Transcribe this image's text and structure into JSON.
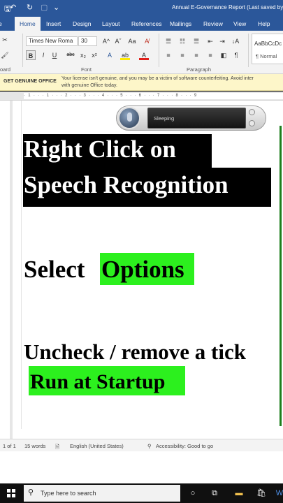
{
  "titlebar": {
    "title": "Annual E-Governance Report (Last saved by u",
    "save_glyph": "🖫",
    "undo_glyph": "↶",
    "redo_glyph": "↻",
    "dropdown_glyph": "⌄"
  },
  "ribbon_tabs": [
    "Home",
    "Insert",
    "Design",
    "Layout",
    "References",
    "Mailings",
    "Review",
    "View",
    "Help"
  ],
  "ribbon": {
    "font_name": "Times New Roma",
    "font_size": "30",
    "group_clipboard": "oard",
    "group_font": "Font",
    "group_paragraph": "Paragraph",
    "style_preview": "AaBbCcDc",
    "style_name": "¶ Normal",
    "bold": "B",
    "italic": "I",
    "underline": "U",
    "strike": "abc",
    "subscript": "x₂",
    "superscript": "x²",
    "grow_font": "A^",
    "shrink_font": "Aˇ",
    "case": "Aa",
    "font_color": "A",
    "highlight": "ab",
    "pilcrow": "¶",
    "sort": "↓A"
  },
  "banner": {
    "label": "GET GENUINE OFFICE",
    "message_line1": "Your license isn't genuine, and you may be a victim of software counterfeiting. Avoid inter",
    "message_line2": "with genuine Office today."
  },
  "ruler_marks": "· 1 · · · 1 · · · 2 · · · 3 · · · 4 · · · 5 · · · 6 · · · 7 · · · 8 · · · 9",
  "speech": {
    "status": "Sleeping"
  },
  "document": {
    "line1": "Right Click on",
    "line2": "Speech Recognition",
    "select": "Select",
    "options": "Options",
    "uncheck": "Uncheck / remove a tick",
    "run_at_startup": "Run at Startup"
  },
  "statusbar": {
    "page": "1 of 1",
    "words": "15 words",
    "language": "English (United States)",
    "accessibility": "Accessibility: Good to go"
  },
  "taskbar": {
    "search_placeholder": "Type here to search"
  },
  "colors": {
    "word_blue": "#2b579a",
    "highlight_green": "#2cf01e",
    "banner_yellow": "#fdf6c9"
  }
}
